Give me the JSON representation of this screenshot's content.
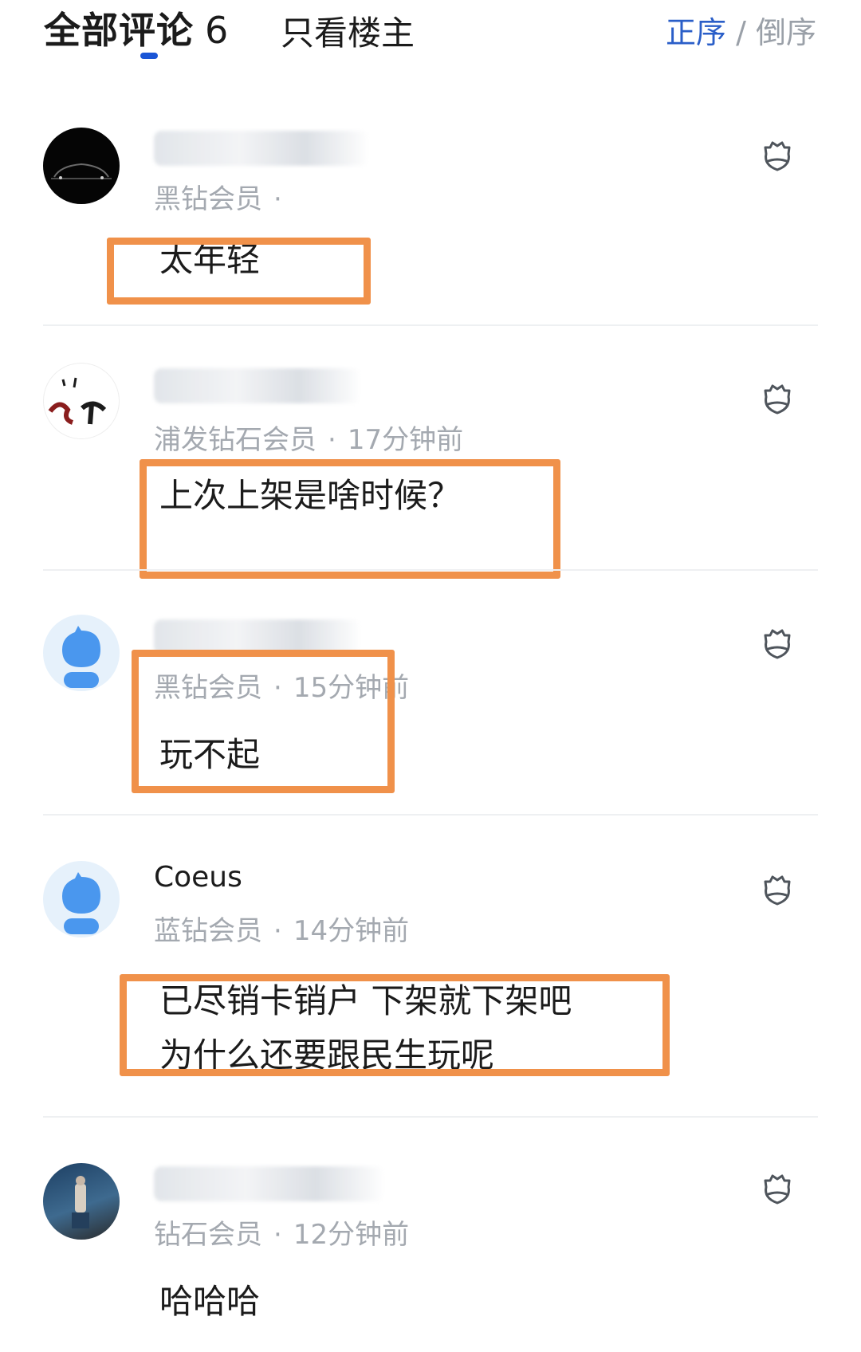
{
  "header": {
    "all_comments_label": "全部评论",
    "all_comments_count": "6",
    "op_only_label": "只看楼主",
    "sort_asc_label": "正序",
    "sort_separator": "/",
    "sort_desc_label": "倒序"
  },
  "comments": [
    {
      "member": "黑钻会员",
      "time": "",
      "text_lines": [
        "太年轻"
      ]
    },
    {
      "member": "浦发钻石会员",
      "time": "17分钟前",
      "text_lines": [
        "上次上架是啥时候？"
      ]
    },
    {
      "member": "黑钻会员",
      "time": "15分钟前",
      "text_lines": [
        "玩不起"
      ]
    },
    {
      "username": "Coeus",
      "member": "蓝钻会员",
      "time": "14分钟前",
      "text_lines": [
        "已尽销卡销户 下架就下架吧",
        "为什么还要跟民生玩呢"
      ]
    },
    {
      "member": "钻石会员",
      "time": "12分钟前",
      "text_lines": [
        "哈哈哈"
      ]
    }
  ],
  "icons": {
    "like": "like-icon"
  },
  "colors": {
    "accent": "#2a5ec8",
    "highlight_box": "#f0914a",
    "meta_text": "#a4a9b0"
  }
}
